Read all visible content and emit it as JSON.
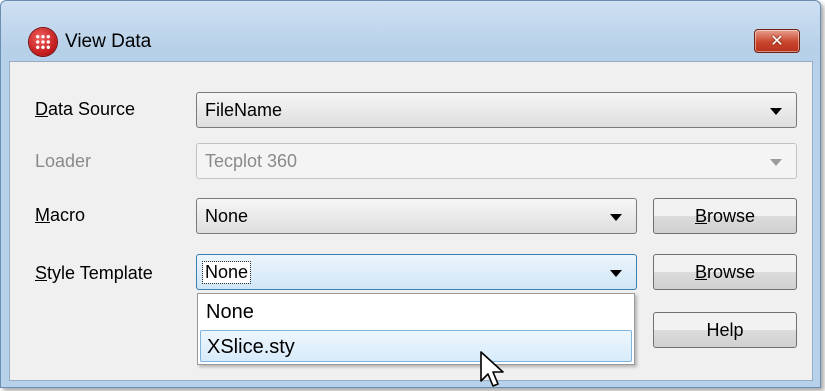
{
  "window": {
    "title": "View Data",
    "close_glyph": "✕"
  },
  "fields": {
    "data_source": {
      "label": "Data Source",
      "accel": "D",
      "value": "FileName"
    },
    "loader": {
      "label": "Loader",
      "value": "Tecplot 360",
      "enabled": false
    },
    "macro": {
      "label": "Macro",
      "accel": "M",
      "value": "None"
    },
    "style_template": {
      "label": "Style Template",
      "accel": "S",
      "value": "None"
    }
  },
  "buttons": {
    "macro_browse": "Browse",
    "style_browse": "Browse",
    "help": "Help"
  },
  "dropdown": {
    "options": [
      "None",
      "XSlice.sty"
    ],
    "hovered_index": 1
  },
  "icons": {
    "app": "tecplot-app-icon",
    "close": "close-icon",
    "combo_arrow": "chevron-down-icon",
    "cursor": "mouse-pointer-icon"
  },
  "colors": {
    "titlebar": "#b7d1ea",
    "close_button": "#c9452d",
    "focus_border": "#3c7fb1",
    "hover_border": "#7fb4e0"
  }
}
